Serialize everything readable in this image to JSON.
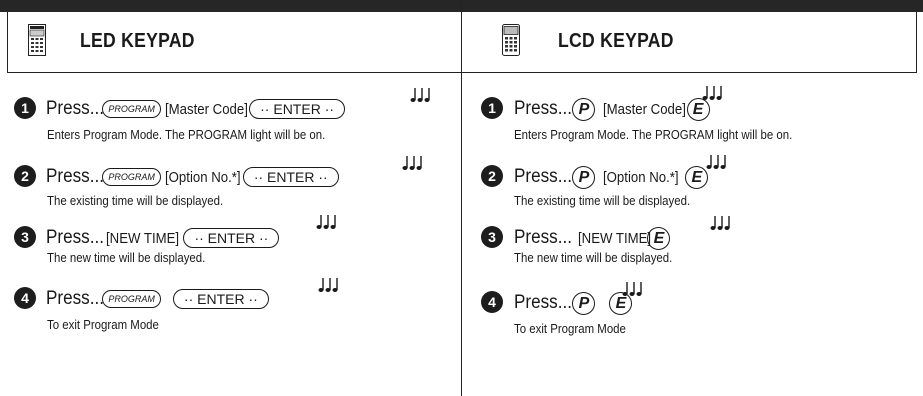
{
  "left": {
    "title": "LED KEYPAD",
    "steps": [
      {
        "num": "1",
        "press": "Press...",
        "key1": "PROGRAM",
        "mid": "[Master Code]",
        "enter": "·· ENTER ··",
        "desc": "Enters Program Mode. The PROGRAM light will be on."
      },
      {
        "num": "2",
        "press": "Press...",
        "key1": "PROGRAM",
        "mid": "[Option No.*]",
        "enter": "·· ENTER ··",
        "desc": "The existing time will be displayed."
      },
      {
        "num": "3",
        "press": "Press...",
        "mid": "[NEW TIME]",
        "enter": "·· ENTER ··",
        "desc": "The new time will be displayed."
      },
      {
        "num": "4",
        "press": "Press...",
        "key1": "PROGRAM",
        "enter": "·· ENTER ··",
        "desc": "To exit Program Mode"
      }
    ]
  },
  "right": {
    "title": "LCD KEYPAD",
    "steps": [
      {
        "num": "1",
        "press": "Press...",
        "p": "P",
        "mid": "[Master Code]",
        "e": "E",
        "desc": "Enters Program Mode. The PROGRAM light will be on."
      },
      {
        "num": "2",
        "press": "Press...",
        "p": "P",
        "mid": "[Option No.*]",
        "e": "E",
        "desc": "The existing time will be displayed."
      },
      {
        "num": "3",
        "press": "Press...",
        "mid": "[NEW TIME]",
        "e": "E",
        "desc": "The new time will be displayed."
      },
      {
        "num": "4",
        "press": "Press...",
        "p": "P",
        "e": "E",
        "desc": "To exit Program Mode"
      }
    ]
  },
  "icons": {
    "beep": "music-notes-icon",
    "led": "led-keypad-icon",
    "lcd": "lcd-keypad-icon"
  }
}
